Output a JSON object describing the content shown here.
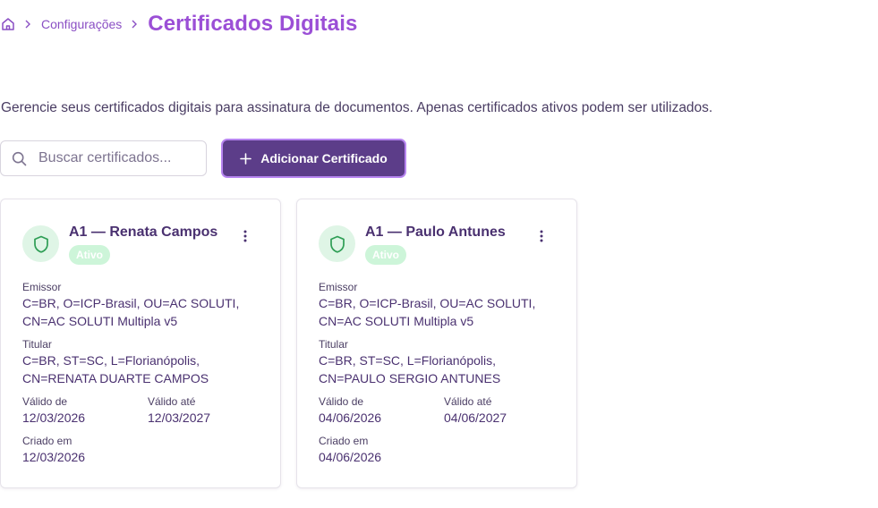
{
  "breadcrumb": {
    "home_icon": "home-icon",
    "section": "Configurações",
    "title": "Certificados Digitais"
  },
  "description": "Gerencie seus certificados digitais para assinatura de documentos. Apenas certificados ativos podem ser utilizados.",
  "search": {
    "placeholder": "Buscar certificados...",
    "value": ""
  },
  "add_button": {
    "label": "Adicionar Certificado",
    "icon": "plus-icon"
  },
  "colors": {
    "primary": "#5c3d89",
    "title_purple": "#9b4fd6",
    "status_green_bg": "#cdf5d9",
    "shield_green": "#2e9e55"
  },
  "labels": {
    "issuer": "Emissor",
    "holder": "Titular",
    "valid_from": "Válido de",
    "valid_until": "Válido até",
    "created_at": "Criado em"
  },
  "certificates": [
    {
      "title": "A1 — Renata Campos",
      "status": "Ativo",
      "issuer_line1": "C=BR, O=ICP-Brasil, OU=AC SOLUTI,",
      "issuer_line2": "CN=AC SOLUTI Multipla v5",
      "holder_line1": "C=BR, ST=SC, L=Florianópolis,",
      "holder_line2": "CN=RENATA DUARTE CAMPOS",
      "valid_from": "12/03/2026",
      "valid_until": "12/03/2027",
      "created_at": "12/03/2026"
    },
    {
      "title": "A1 — Paulo Antunes",
      "status": "Ativo",
      "issuer_line1": "C=BR, O=ICP-Brasil, OU=AC SOLUTI,",
      "issuer_line2": "CN=AC SOLUTI Multipla v5",
      "holder_line1": "C=BR, ST=SC, L=Florianópolis,",
      "holder_line2": "CN=PAULO SERGIO ANTUNES",
      "valid_from": "04/06/2026",
      "valid_until": "04/06/2027",
      "created_at": "04/06/2026"
    }
  ]
}
